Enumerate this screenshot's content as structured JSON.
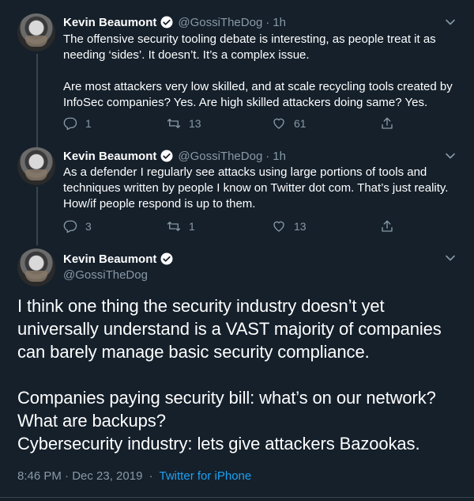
{
  "tweets": [
    {
      "name": "Kevin Beaumont",
      "handle": "@GossiTheDog",
      "separator": "·",
      "time": "1h",
      "text": "The offensive security tooling debate is interesting, as people treat it as\nneeding ‘sides’. It doesn’t. It’s a complex issue.\n\nAre most attackers very low skilled, and at scale recycling tools created by\nInfoSec companies? Yes. Are high skilled attackers doing same? Yes.",
      "replies": "1",
      "retweets": "13",
      "likes": "61"
    },
    {
      "name": "Kevin Beaumont",
      "handle": "@GossiTheDog",
      "separator": "·",
      "time": "1h",
      "text": "As a defender I regularly see attacks using large portions of tools and\ntechniques written by people I know on Twitter dot com. That’s just reality.\nHow/if people respond is up to them.",
      "replies": "3",
      "retweets": "1",
      "likes": "13"
    }
  ],
  "main_tweet": {
    "name": "Kevin Beaumont",
    "handle": "@GossiTheDog",
    "text": "I think one thing the security industry doesn’t yet\nuniversally understand is a VAST majority of companies\ncan barely manage basic security compliance.\n\nCompanies paying security bill: what’s on our network?\nWhat are backups?\nCybersecurity industry: lets give attackers Bazookas.",
    "timestamp": "8:46 PM · Dec 23, 2019",
    "meta_separator": "·",
    "source": "Twitter for iPhone"
  },
  "colors": {
    "background": "#15202b",
    "secondary_text": "#8899a6",
    "accent": "#1da1f2"
  },
  "icons": [
    "verified-badge-icon",
    "chevron-down-icon",
    "reply-icon",
    "retweet-icon",
    "like-icon",
    "share-icon"
  ]
}
